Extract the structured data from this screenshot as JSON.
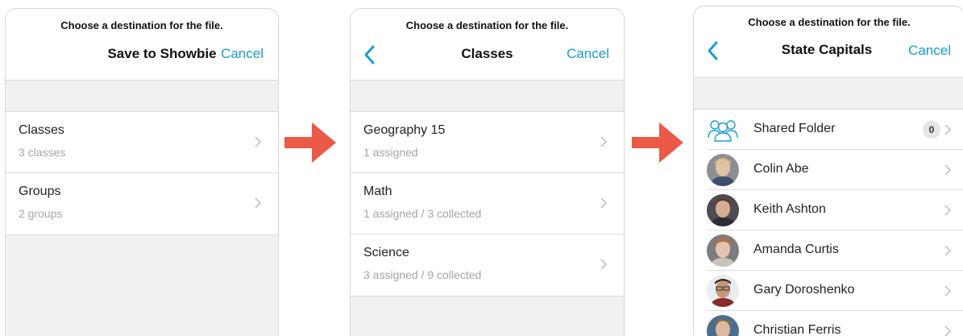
{
  "colors": {
    "accent": "#1b9bd6",
    "arrow": "#ea5a47"
  },
  "panel1": {
    "prompt": "Choose a destination for the file.",
    "title": "Save to Showbie",
    "cancel": "Cancel",
    "rows": [
      {
        "title": "Classes",
        "subtitle": "3 classes"
      },
      {
        "title": "Groups",
        "subtitle": "2 groups"
      }
    ]
  },
  "panel2": {
    "prompt": "Choose a destination for the file.",
    "title": "Classes",
    "cancel": "Cancel",
    "back_icon": "chevron-left-icon",
    "rows": [
      {
        "title": "Geography 15",
        "subtitle": "1 assigned"
      },
      {
        "title": "Math",
        "subtitle": "1 assigned / 3 collected"
      },
      {
        "title": "Science",
        "subtitle": "3 assigned / 9 collected"
      }
    ]
  },
  "panel3": {
    "prompt": "Choose a destination for the file.",
    "title": "State Capitals",
    "cancel": "Cancel",
    "back_icon": "chevron-left-icon",
    "shared_folder": {
      "name": "Shared Folder",
      "count": "0",
      "icon": "group-icon"
    },
    "students": [
      {
        "name": "Colin Abe"
      },
      {
        "name": "Keith Ashton"
      },
      {
        "name": "Amanda Curtis"
      },
      {
        "name": "Gary Doroshenko"
      },
      {
        "name": "Christian Ferris"
      }
    ]
  }
}
